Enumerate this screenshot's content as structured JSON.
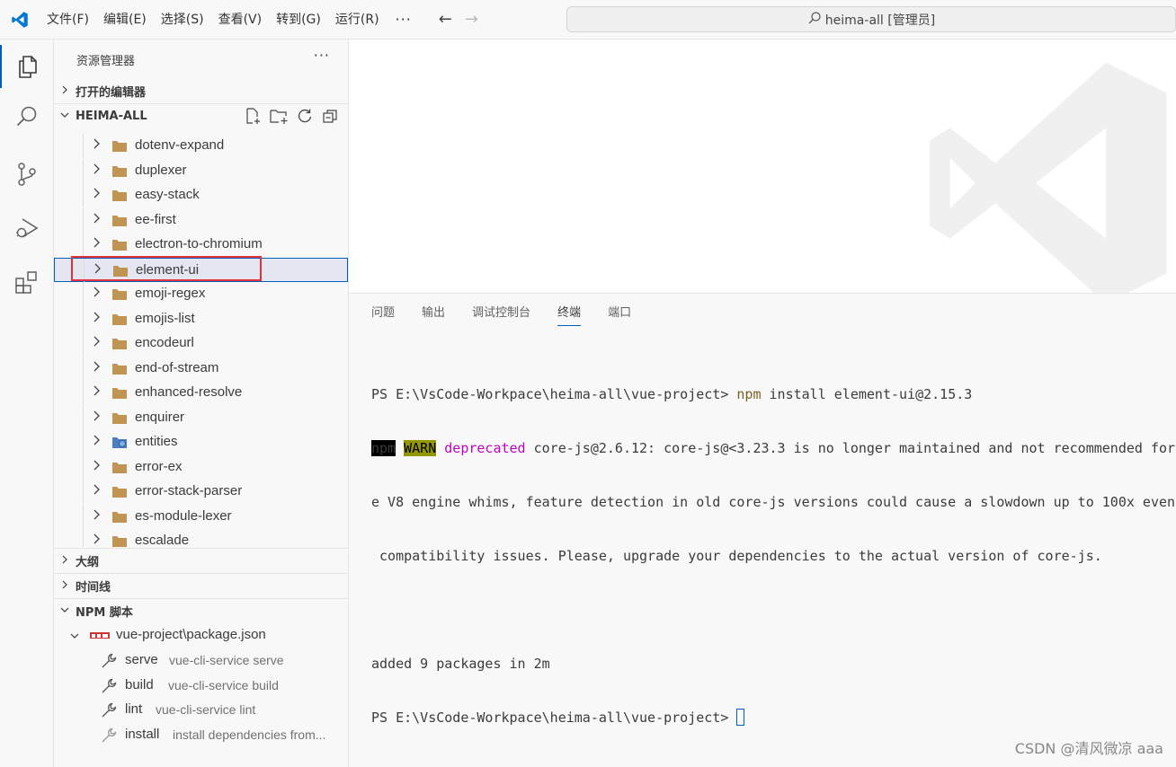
{
  "titlebar": {
    "menus": [
      "文件(F)",
      "编辑(E)",
      "选择(S)",
      "查看(V)",
      "转到(G)",
      "运行(R)"
    ],
    "more": "···",
    "search_text": "heima-all [管理员]"
  },
  "activitybar": {
    "items": [
      "explorer-icon",
      "search-icon",
      "source-control-icon",
      "run-debug-icon",
      "extensions-icon"
    ],
    "active": "explorer-icon"
  },
  "sidebar": {
    "title": "资源管理器",
    "more": "···",
    "open_editors": "打开的编辑器",
    "workspace": "HEIMA-ALL",
    "tree": [
      {
        "label": "dotenv-expand",
        "icon": "folder"
      },
      {
        "label": "duplexer",
        "icon": "folder"
      },
      {
        "label": "easy-stack",
        "icon": "folder"
      },
      {
        "label": "ee-first",
        "icon": "folder"
      },
      {
        "label": "electron-to-chromium",
        "icon": "folder"
      },
      {
        "label": "element-ui",
        "icon": "folder",
        "selected": true
      },
      {
        "label": "emoji-regex",
        "icon": "folder"
      },
      {
        "label": "emojis-list",
        "icon": "folder"
      },
      {
        "label": "encodeurl",
        "icon": "folder"
      },
      {
        "label": "end-of-stream",
        "icon": "folder"
      },
      {
        "label": "enhanced-resolve",
        "icon": "folder"
      },
      {
        "label": "enquirer",
        "icon": "folder"
      },
      {
        "label": "entities",
        "icon": "special-folder"
      },
      {
        "label": "error-ex",
        "icon": "folder"
      },
      {
        "label": "error-stack-parser",
        "icon": "folder"
      },
      {
        "label": "es-module-lexer",
        "icon": "folder"
      },
      {
        "label": "escalade",
        "icon": "folder"
      }
    ],
    "outline": "大纲",
    "timeline": "时间线",
    "npm_scripts": "NPM 脚本",
    "npm_package": "vue-project\\package.json",
    "scripts": [
      {
        "name": "serve",
        "command": "vue-cli-service serve"
      },
      {
        "name": "build",
        "command": "vue-cli-service build"
      },
      {
        "name": "lint",
        "command": "vue-cli-service lint"
      },
      {
        "name": "install",
        "command": "install dependencies from..."
      }
    ]
  },
  "panel": {
    "tabs": [
      "问题",
      "输出",
      "调试控制台",
      "终端",
      "端口"
    ],
    "active_tab": "终端",
    "terminal": {
      "line1_prompt": "PS E:\\VsCode-Workpace\\heima-all\\vue-project> ",
      "line1_cmd": "npm",
      "line1_args": " install element-ui@2.15.3",
      "line2_npm": "npm",
      "line2_warn": "WARN",
      "line2_dep": "deprecated",
      "line2_rest": " core-js@2.6.12: core-js@<3.23.3 is no longer maintained and not recommended for",
      "line3": "e V8 engine whims, feature detection in old core-js versions could cause a slowdown up to 100x even",
      "line4": " compatibility issues. Please, upgrade your dependencies to the actual version of core-js.",
      "line5": "added 9 packages in 2m",
      "line6_prompt": "PS E:\\VsCode-Workpace\\heima-all\\vue-project> "
    }
  },
  "watermark": "CSDN @清风微凉 aaa",
  "colors": {
    "accent": "#005fb8",
    "folder": "#c09553",
    "highlight_box": "#e5323a"
  }
}
